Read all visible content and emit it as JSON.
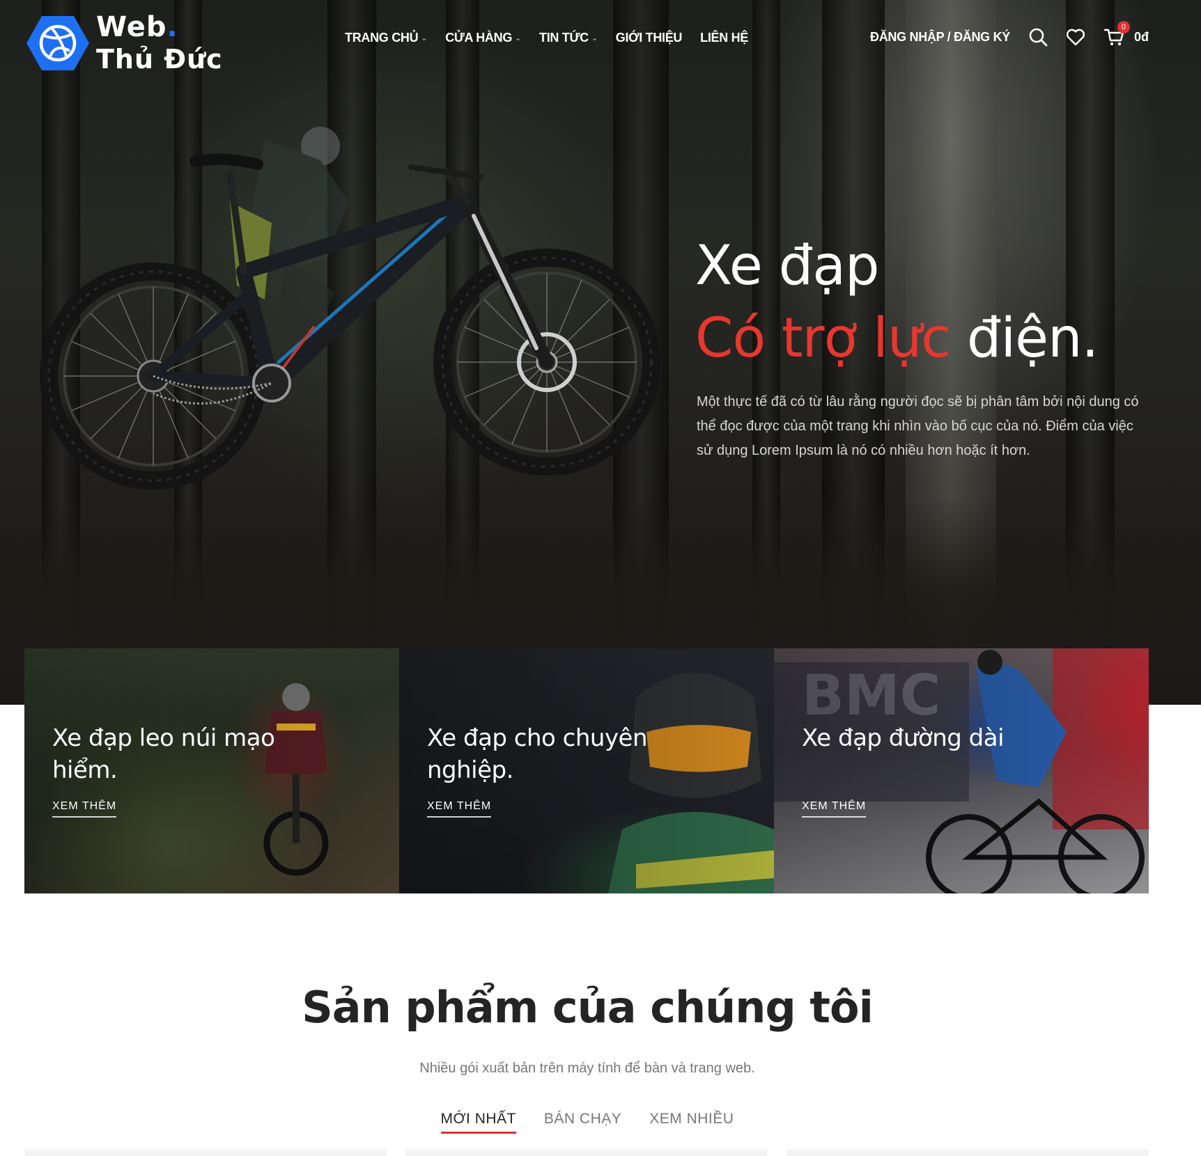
{
  "brand": {
    "line1": "Web",
    "dot": ".",
    "line2": "Thủ Đức",
    "accent": "#1e6ff2"
  },
  "nav": {
    "items": [
      {
        "label": "TRANG CHỦ",
        "has_dropdown": true
      },
      {
        "label": "CỬA HÀNG",
        "has_dropdown": true
      },
      {
        "label": "TIN TỨC",
        "has_dropdown": true
      },
      {
        "label": "GIỚI THIỆU",
        "has_dropdown": false
      },
      {
        "label": "LIÊN HỆ",
        "has_dropdown": false
      }
    ]
  },
  "header": {
    "login_label": "ĐĂNG NHẬP / ĐĂNG KÝ",
    "cart_count": "0",
    "cart_total": "0đ",
    "icons": [
      "search-icon",
      "heart-icon",
      "cart-icon"
    ]
  },
  "hero": {
    "title_line1": "Xe đạp",
    "title_line2_red": "Có trợ lực",
    "title_line2_white": " điện.",
    "description": "Một thực tế đã có từ lâu rằng người đọc sẽ bị phân tâm bởi nội dung có thể đọc được của một trang khi nhìn vào bố cục của nó. Điểm của việc sử dụng Lorem Ipsum là nó có nhiều hơn hoặc ít hơn.",
    "accent_red": "#e8372f"
  },
  "categories": [
    {
      "title": "Xe đạp leo núi mạo hiểm.",
      "link": "XEM THÊM"
    },
    {
      "title": "Xe đạp cho chuyên nghiệp.",
      "link": "XEM THÊM"
    },
    {
      "title": "Xe đạp đường dài",
      "link": "XEM THÊM"
    }
  ],
  "products": {
    "title": "Sản phẩm của chúng tôi",
    "subtitle": "Nhiều gói xuất bản trên máy tính để bàn và trang web.",
    "tabs": [
      {
        "label": "MỚI NHẤT",
        "active": true
      },
      {
        "label": "BÁN CHẠY",
        "active": false
      },
      {
        "label": "XEM NHIỀU",
        "active": false
      }
    ]
  }
}
